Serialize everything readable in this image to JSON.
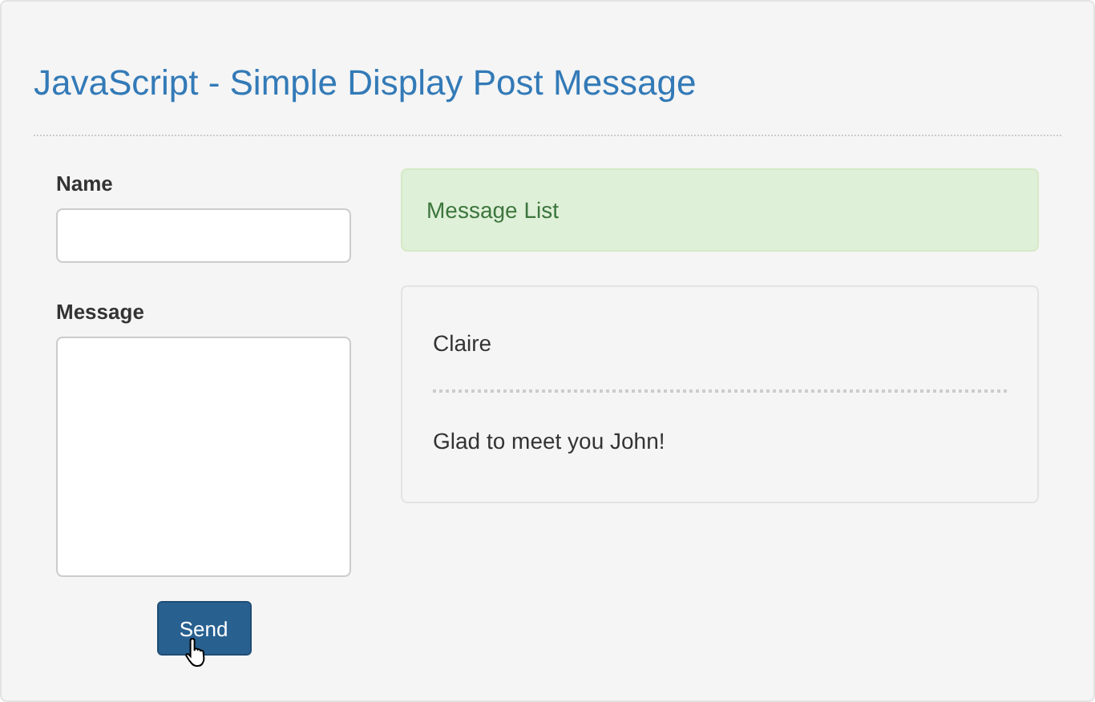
{
  "title": "JavaScript - Simple Display Post Message",
  "form": {
    "fields": [
      {
        "label": "Name",
        "kind": "input"
      },
      {
        "label": "Message",
        "kind": "textarea"
      }
    ],
    "button": "Send"
  },
  "message_list": {
    "heading": "Message List",
    "messages": [
      {
        "author": "Claire",
        "text": "Glad to meet you John!"
      }
    ]
  }
}
